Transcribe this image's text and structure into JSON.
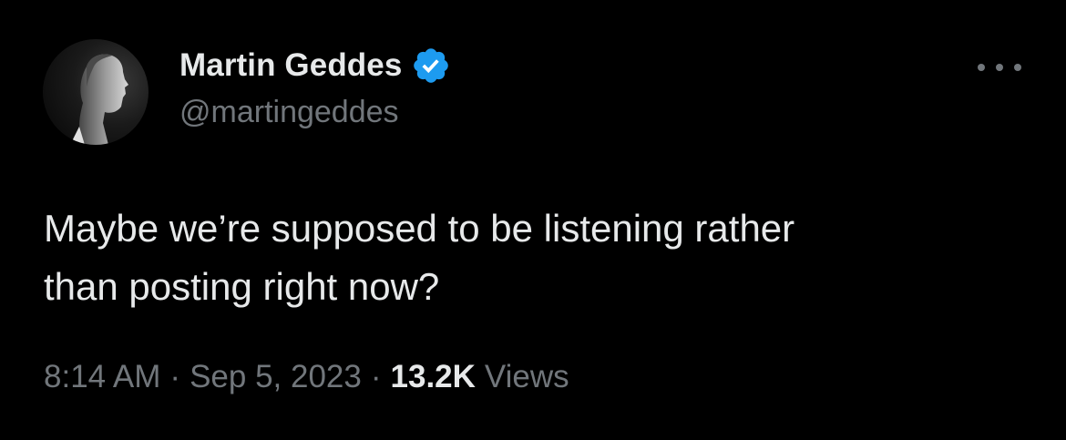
{
  "tweet": {
    "author": {
      "display_name": "Martin Geddes",
      "handle": "@martingeddes",
      "verified": true,
      "verified_icon": "verified-badge-icon",
      "avatar": "profile-photo"
    },
    "more_icon": "more-options-icon",
    "text": "Maybe we’re supposed to be listening rather\nthan posting right now?",
    "meta": {
      "time": "8:14 AM",
      "separator": "·",
      "date": "Sep 5, 2023",
      "views_count": "13.2K",
      "views_label": "Views"
    }
  },
  "colors": {
    "background": "#000000",
    "primary_text": "#e7e9ea",
    "secondary_text": "#71767b",
    "verified_blue": "#1d9bf0"
  }
}
